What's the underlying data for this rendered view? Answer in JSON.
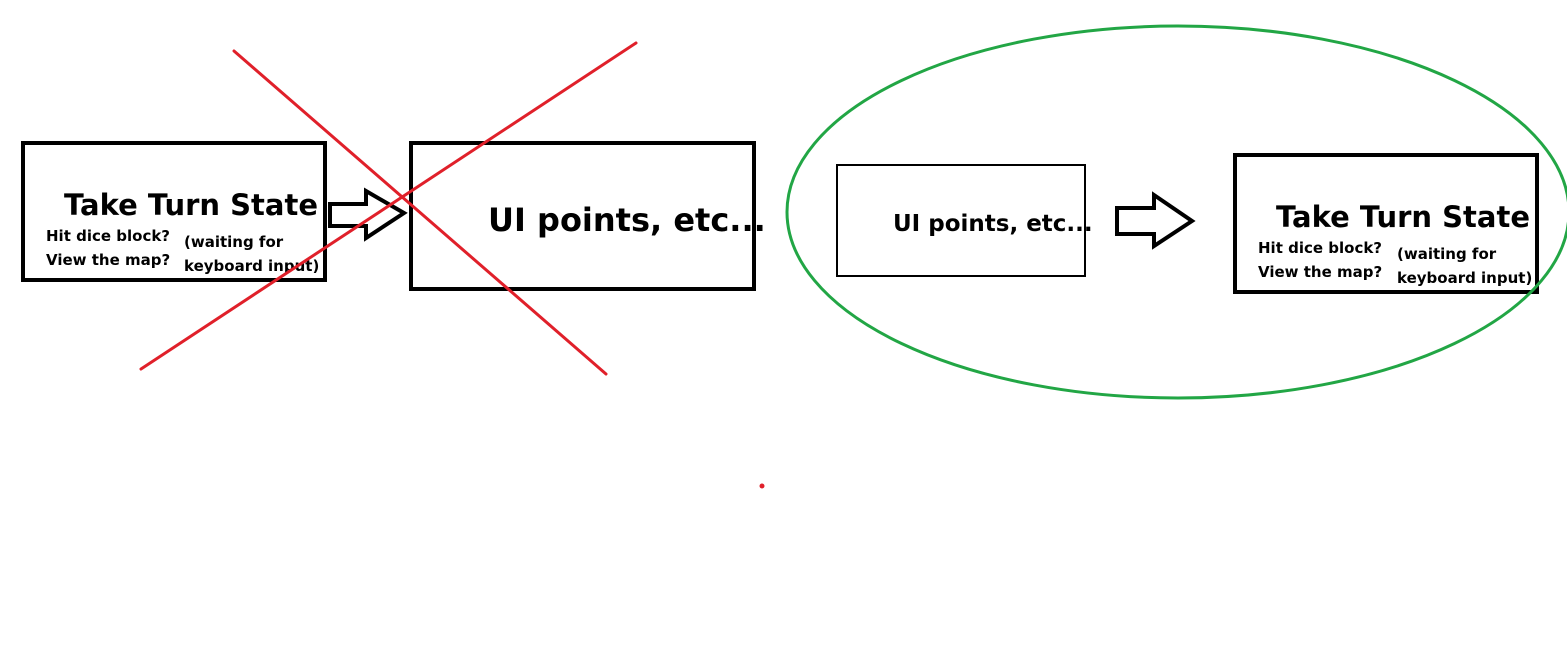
{
  "colors": {
    "stroke": "#000000",
    "reject_cross": "#e0202a",
    "approved_ellipse": "#22a645",
    "background": "#ffffff"
  },
  "rejected_flow": {
    "state_box": {
      "title": "Take Turn State",
      "options": [
        "Hit dice block?",
        "View the map?"
      ],
      "note_line1": "(waiting for",
      "note_line2": "keyboard input)"
    },
    "ui_box": {
      "label": "UI points, etc..."
    },
    "arrow_icon": "right-arrow-icon",
    "mark_icon": "red-x-cross-icon"
  },
  "approved_flow": {
    "ui_box": {
      "label": "UI points, etc..."
    },
    "state_box": {
      "title": "Take Turn State",
      "options": [
        "Hit dice block?",
        "View the map?"
      ],
      "note_line1": "(waiting for",
      "note_line2": "keyboard input)"
    },
    "arrow_icon": "right-arrow-icon",
    "mark_icon": "green-ellipse-icon"
  }
}
